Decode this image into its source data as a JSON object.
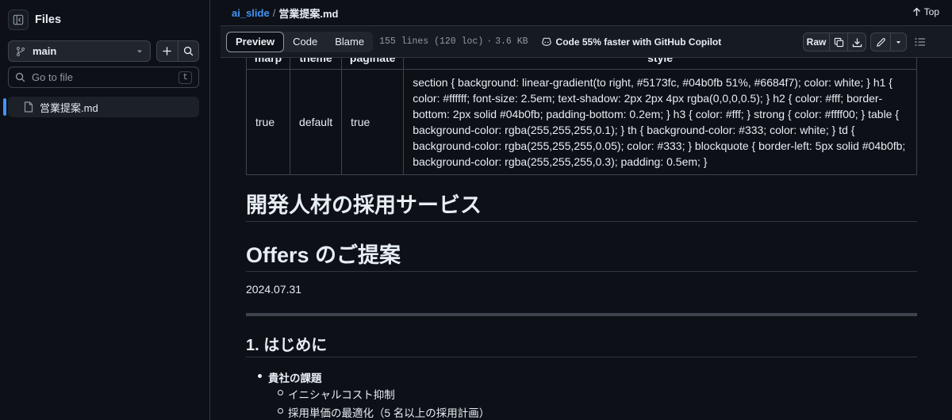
{
  "sidebar": {
    "title": "Files",
    "branch": "main",
    "goto_placeholder": "Go to file",
    "goto_shortcut": "t",
    "files": [
      {
        "name": "営業提案.md"
      }
    ]
  },
  "breadcrumb": {
    "repo": "ai_slide",
    "separator": "/",
    "file": "営業提案.md"
  },
  "top_button": "Top",
  "toolbar": {
    "tabs": [
      "Preview",
      "Code",
      "Blame"
    ],
    "active_tab": "Preview",
    "lines_info": "155 lines (120 loc)",
    "dot": "·",
    "size": "3.6 KB",
    "copilot_text": "Code 55% faster with GitHub Copilot",
    "raw_label": "Raw"
  },
  "frontmatter": {
    "headers": [
      "marp",
      "theme",
      "paginate",
      "style"
    ],
    "row": [
      "true",
      "default",
      "true",
      "section { background: linear-gradient(to right, #5173fc, #04b0fb 51%, #6684f7); color: white; } h1 { color: #ffffff; font-size: 2.5em; text-shadow: 2px 2px 4px rgba(0,0,0,0.5); } h2 { color: #fff; border-bottom: 2px solid #04b0fb; padding-bottom: 0.2em; } h3 { color: #fff; } strong { color: #ffff00; } table { background-color: rgba(255,255,255,0.1); } th { background-color: #333; color: white; } td { background-color: rgba(255,255,255,0.05); color: #333; } blockquote { border-left: 5px solid #04b0fb; background-color: rgba(255,255,255,0.3); padding: 0.5em; }"
    ]
  },
  "doc": {
    "h1_a": "開発人材の採用サービス",
    "h1_b": "Offers のご提案",
    "date": "2024.07.31",
    "h2": "1. はじめに",
    "list_title": "貴社の課題",
    "list_items": [
      "イニシャルコスト抑制",
      "採用単価の最適化（5 名以上の採用計画）"
    ]
  },
  "colors": {
    "accent": "#4493f8",
    "bg": "#0d1117",
    "border": "#30363d"
  }
}
